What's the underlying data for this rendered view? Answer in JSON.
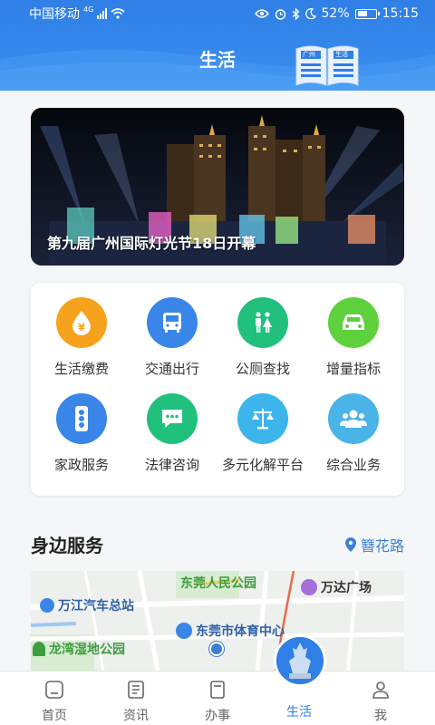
{
  "status_bar": {
    "carrier": "中国移动",
    "network": "4G",
    "battery": "52%",
    "time": "15:15"
  },
  "header": {
    "title": "生活",
    "book_left": "广州",
    "book_right": "生活"
  },
  "banner": {
    "caption": "第九届广州国际灯光节18日开幕"
  },
  "services": [
    {
      "label": "生活缴费",
      "icon": "yen-drop-icon",
      "color": "#f6a21c"
    },
    {
      "label": "交通出行",
      "icon": "bus-icon",
      "color": "#3a86e8"
    },
    {
      "label": "公厕查找",
      "icon": "restroom-icon",
      "color": "#21c07c"
    },
    {
      "label": "增量指标",
      "icon": "car-icon",
      "color": "#5fd13c"
    },
    {
      "label": "家政服务",
      "icon": "traffic-light-icon",
      "color": "#3a86e8"
    },
    {
      "label": "法律咨询",
      "icon": "chat-icon",
      "color": "#21c07c"
    },
    {
      "label": "多元化解平台",
      "icon": "scale-icon",
      "color": "#3bb5ec"
    },
    {
      "label": "综合业务",
      "icon": "people-icon",
      "color": "#4ab3e8"
    }
  ],
  "nearby": {
    "title": "身边服务",
    "location": "簪花路",
    "map_labels": {
      "a": "东莞人民公园",
      "b": "万达广场",
      "c": "万江汽车总站",
      "d": "东莞市体育中心",
      "e": "龙湾湿地公园"
    }
  },
  "tabs": [
    {
      "label": "首页",
      "icon": "home-icon"
    },
    {
      "label": "资讯",
      "icon": "news-icon"
    },
    {
      "label": "办事",
      "icon": "tasks-icon"
    },
    {
      "label": "生活",
      "icon": "life-icon"
    },
    {
      "label": "我",
      "icon": "user-icon"
    }
  ],
  "colors": {
    "brand": "#2f7fe6",
    "link": "#3b7fd6"
  }
}
